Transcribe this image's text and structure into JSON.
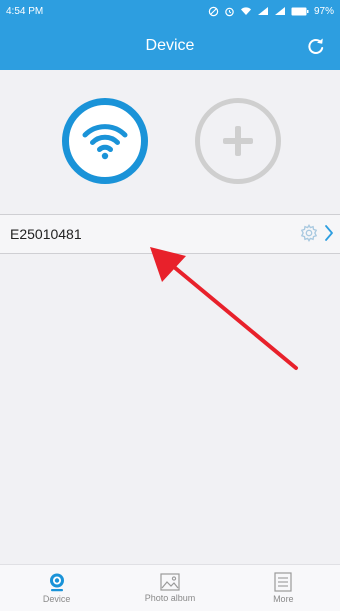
{
  "status_bar": {
    "time": "4:54 PM",
    "battery": "97%"
  },
  "header": {
    "title": "Device",
    "refresh_icon": "refresh-icon"
  },
  "actions": {
    "wifi_icon": "wifi-icon",
    "add_icon": "plus-icon"
  },
  "devices": [
    {
      "name": "E25010481"
    }
  ],
  "tabs": [
    {
      "label": "Device",
      "icon": "camera-icon",
      "active": true
    },
    {
      "label": "Photo album",
      "icon": "photo-icon",
      "active": false
    },
    {
      "label": "More",
      "icon": "list-icon",
      "active": false
    }
  ],
  "colors": {
    "header_blue": "#2d9ee0",
    "wifi_blue": "#1a93d8",
    "annotation_red": "#e8212b"
  }
}
